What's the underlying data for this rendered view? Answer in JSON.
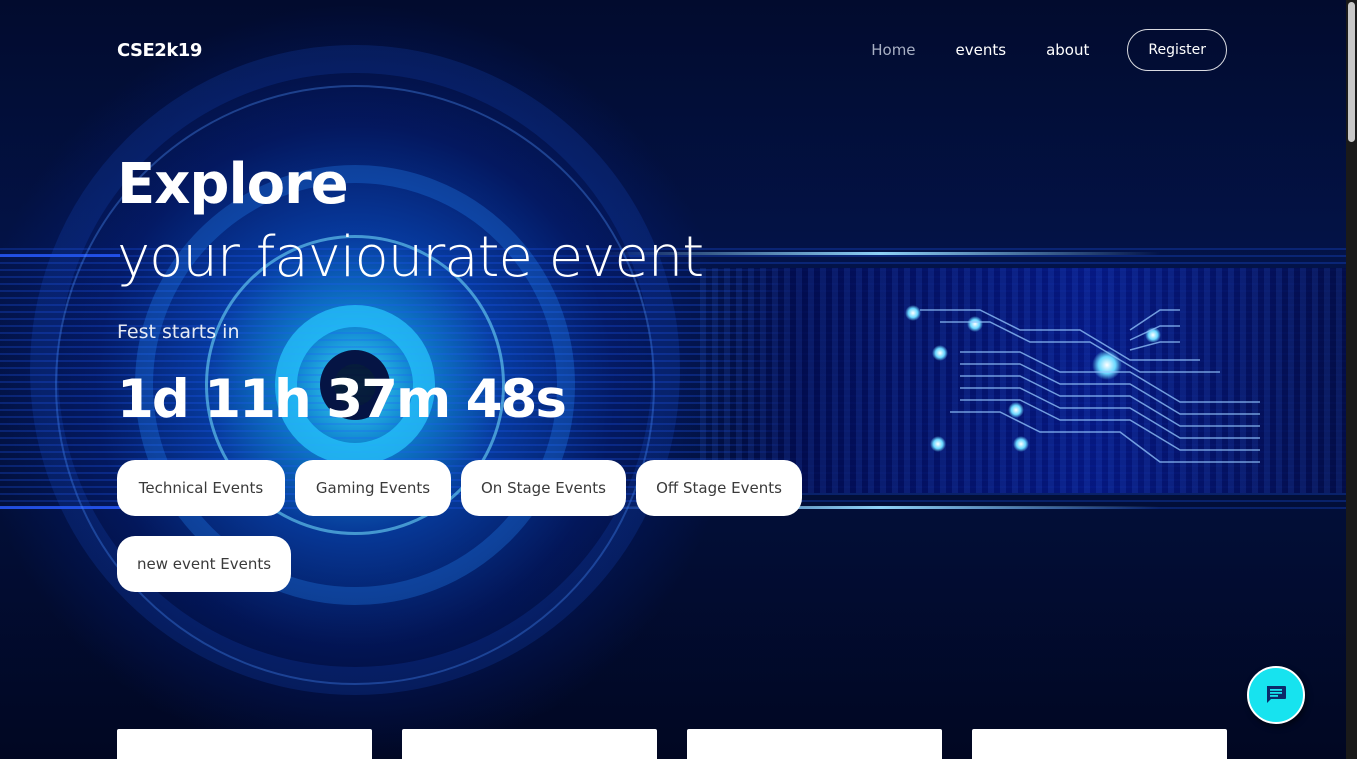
{
  "nav": {
    "brand": "CSE2k19",
    "links": [
      {
        "label": "Home",
        "active": true
      },
      {
        "label": "events",
        "active": false
      },
      {
        "label": "about",
        "active": false
      }
    ],
    "register_label": "Register"
  },
  "hero": {
    "title": "Explore",
    "subtitle": "your faviourate event",
    "fest_label": "Fest starts in",
    "countdown": "1d 11h 37m 48s"
  },
  "event_categories": [
    "Technical Events",
    "Gaming Events",
    "On Stage Events",
    "Off Stage Events",
    "new event Events"
  ],
  "colors": {
    "chat_button": "#17e3ef",
    "background": "#020a2a",
    "active_nav": "#a8b0c4"
  },
  "icons": {
    "chat": "chat-bubble-icon"
  }
}
